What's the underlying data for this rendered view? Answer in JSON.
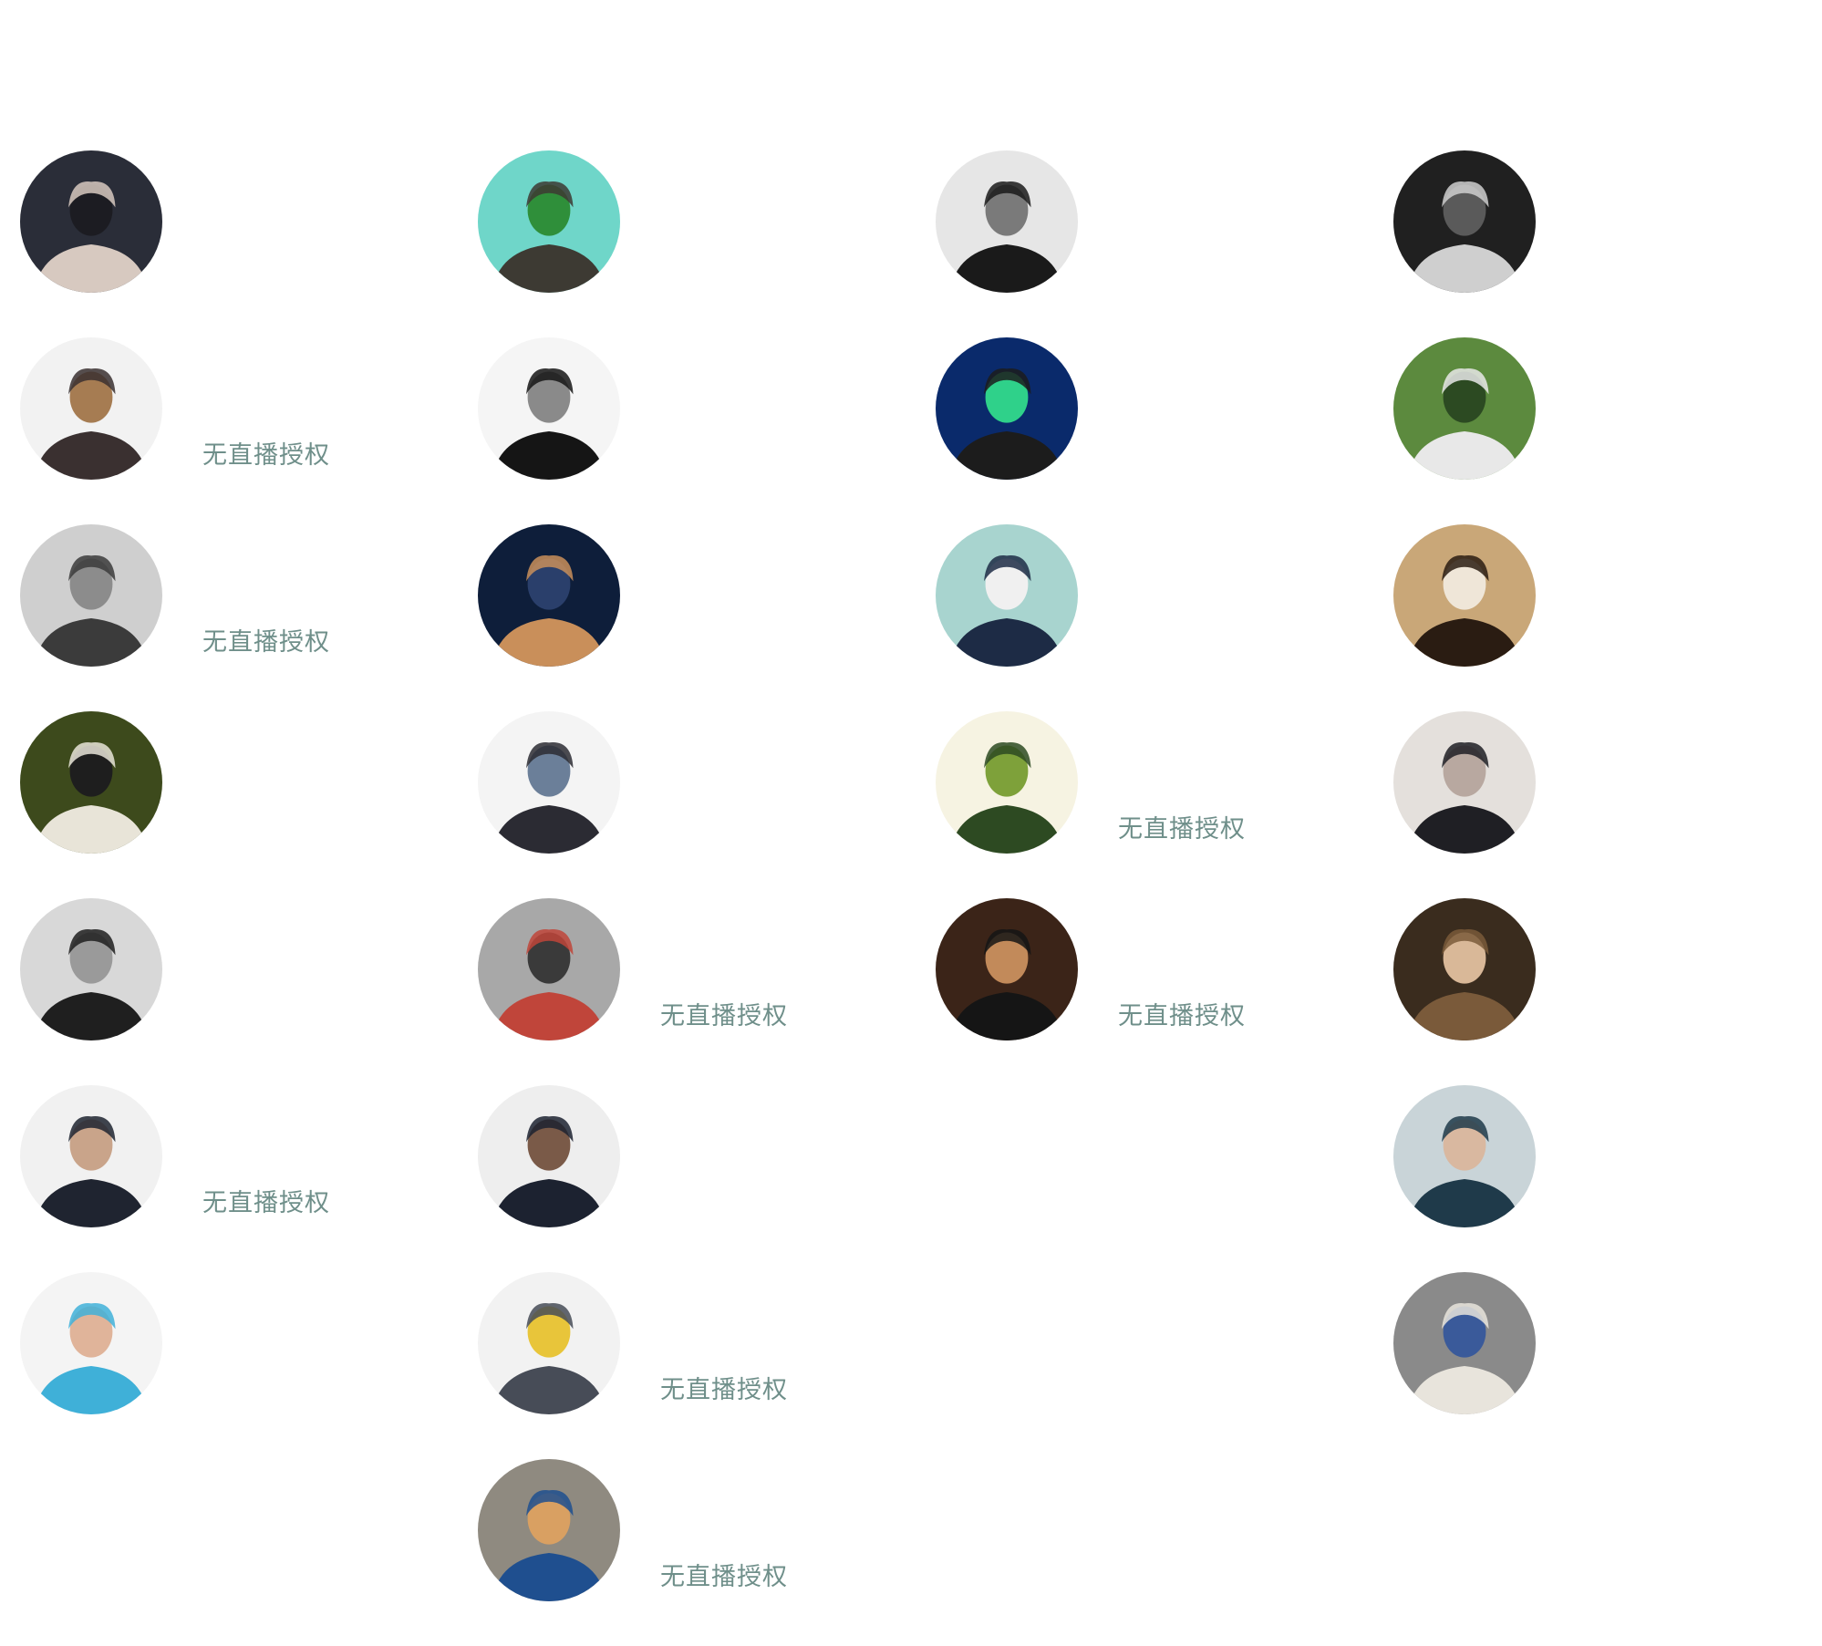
{
  "no_live_label": "无直播授权",
  "columns": [
    {
      "artists": [
        {
          "no_live": false,
          "colors": [
            "#2a2d38",
            "#d7c9c0",
            "#1c1c22"
          ]
        },
        {
          "no_live": true,
          "colors": [
            "#f2f2f2",
            "#3a3030",
            "#a67c52"
          ]
        },
        {
          "no_live": true,
          "colors": [
            "#cfcfcf",
            "#3b3b3b",
            "#8c8c8c"
          ]
        },
        {
          "no_live": false,
          "colors": [
            "#3d4a1c",
            "#e8e4d8",
            "#1e1e1e"
          ]
        },
        {
          "no_live": false,
          "colors": [
            "#d8d8d8",
            "#1f1f1f",
            "#9a9a9a"
          ]
        },
        {
          "no_live": true,
          "colors": [
            "#f1f1f1",
            "#1f2430",
            "#c9a48a"
          ]
        },
        {
          "no_live": false,
          "colors": [
            "#f4f4f4",
            "#3fb0d8",
            "#e0b49a"
          ]
        }
      ]
    },
    {
      "artists": [
        {
          "no_live": false,
          "colors": [
            "#6fd6c9",
            "#3d3a33",
            "#2f8f3a"
          ]
        },
        {
          "no_live": false,
          "colors": [
            "#f5f5f5",
            "#151515",
            "#8a8a8a"
          ]
        },
        {
          "no_live": false,
          "colors": [
            "#0e1e3a",
            "#c98f5a",
            "#2a3f6b"
          ]
        },
        {
          "no_live": false,
          "colors": [
            "#f4f4f4",
            "#2b2b33",
            "#6b7f99"
          ]
        },
        {
          "no_live": true,
          "colors": [
            "#a8a8a8",
            "#c0453a",
            "#3a3a3a"
          ]
        },
        {
          "no_live": false,
          "colors": [
            "#eeeeee",
            "#1c2230",
            "#7a5a48"
          ]
        },
        {
          "no_live": true,
          "colors": [
            "#f2f2f2",
            "#474c57",
            "#e8c53a"
          ]
        },
        {
          "no_live": true,
          "colors": [
            "#8f8a80",
            "#1f4f8f",
            "#d9a062"
          ]
        }
      ]
    },
    {
      "artists": [
        {
          "no_live": false,
          "colors": [
            "#e6e6e6",
            "#1a1a1a",
            "#7a7a7a"
          ]
        },
        {
          "no_live": false,
          "colors": [
            "#0a2a6b",
            "#1c1c1c",
            "#2fd18a"
          ]
        },
        {
          "no_live": false,
          "colors": [
            "#a8d4cf",
            "#1d2b45",
            "#f0f0f0"
          ]
        },
        {
          "no_live": true,
          "colors": [
            "#f6f3e2",
            "#2d4a22",
            "#7ea13a"
          ]
        },
        {
          "no_live": true,
          "colors": [
            "#3b2418",
            "#151515",
            "#c28a5a"
          ]
        }
      ]
    },
    {
      "artists": [
        {
          "no_live": false,
          "colors": [
            "#202020",
            "#cfcfcf",
            "#5a5a5a"
          ]
        },
        {
          "no_live": false,
          "colors": [
            "#5c8a3e",
            "#e8e8e8",
            "#2c4a22"
          ]
        },
        {
          "no_live": false,
          "colors": [
            "#c9a778",
            "#2a1c12",
            "#efe6d8"
          ]
        },
        {
          "no_live": false,
          "colors": [
            "#e4e0dc",
            "#1f1f24",
            "#b8a8a0"
          ]
        },
        {
          "no_live": false,
          "colors": [
            "#3a2c1e",
            "#7a5a3a",
            "#d9b898"
          ]
        },
        {
          "no_live": false,
          "colors": [
            "#c9d4d8",
            "#1f3a4a",
            "#d9b8a0"
          ]
        },
        {
          "no_live": false,
          "colors": [
            "#8a8a8a",
            "#e8e4dc",
            "#3a5a9a"
          ]
        }
      ]
    }
  ]
}
